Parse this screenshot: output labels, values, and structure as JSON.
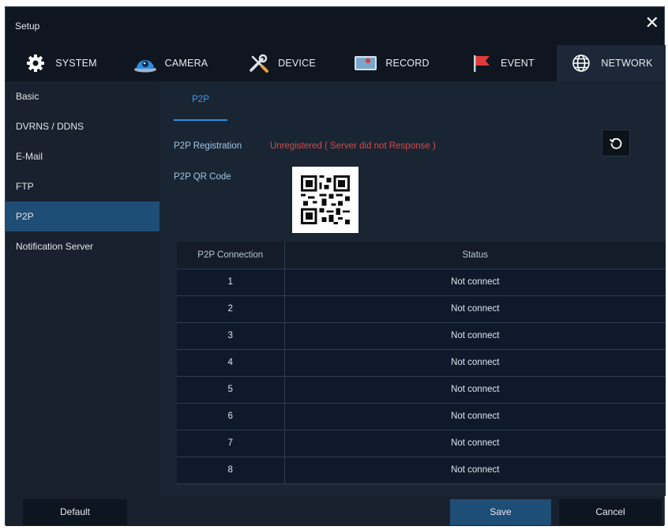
{
  "window": {
    "title": "Setup",
    "close_glyph": "✕"
  },
  "tabs": [
    {
      "label": "SYSTEM",
      "icon": "gear-icon"
    },
    {
      "label": "CAMERA",
      "icon": "camera-icon"
    },
    {
      "label": "DEVICE",
      "icon": "tools-icon"
    },
    {
      "label": "RECORD",
      "icon": "record-icon"
    },
    {
      "label": "EVENT",
      "icon": "flag-icon"
    },
    {
      "label": "NETWORK",
      "icon": "globe-icon",
      "active": true
    }
  ],
  "sidebar": {
    "items": [
      {
        "label": "Basic"
      },
      {
        "label": "DVRNS / DDNS"
      },
      {
        "label": "E-Mail"
      },
      {
        "label": "FTP"
      },
      {
        "label": "P2P",
        "active": true
      },
      {
        "label": "Notification Server"
      }
    ]
  },
  "content": {
    "subtab": "P2P",
    "registration_label": "P2P Registration",
    "registration_status": "Unregistered ( Server did not Response )",
    "qr_label": "P2P QR Code",
    "table": {
      "headers": [
        "P2P Connection",
        "Status"
      ],
      "rows": [
        [
          "1",
          "Not connect"
        ],
        [
          "2",
          "Not connect"
        ],
        [
          "3",
          "Not connect"
        ],
        [
          "4",
          "Not connect"
        ],
        [
          "5",
          "Not connect"
        ],
        [
          "6",
          "Not connect"
        ],
        [
          "7",
          "Not connect"
        ],
        [
          "8",
          "Not connect"
        ]
      ]
    }
  },
  "footer": {
    "default_label": "Default",
    "save_label": "Save",
    "cancel_label": "Cancel"
  },
  "colors": {
    "accent_blue": "#2f8fe0",
    "selected_bg": "#1e4d75",
    "error_red": "#d64a4a"
  }
}
